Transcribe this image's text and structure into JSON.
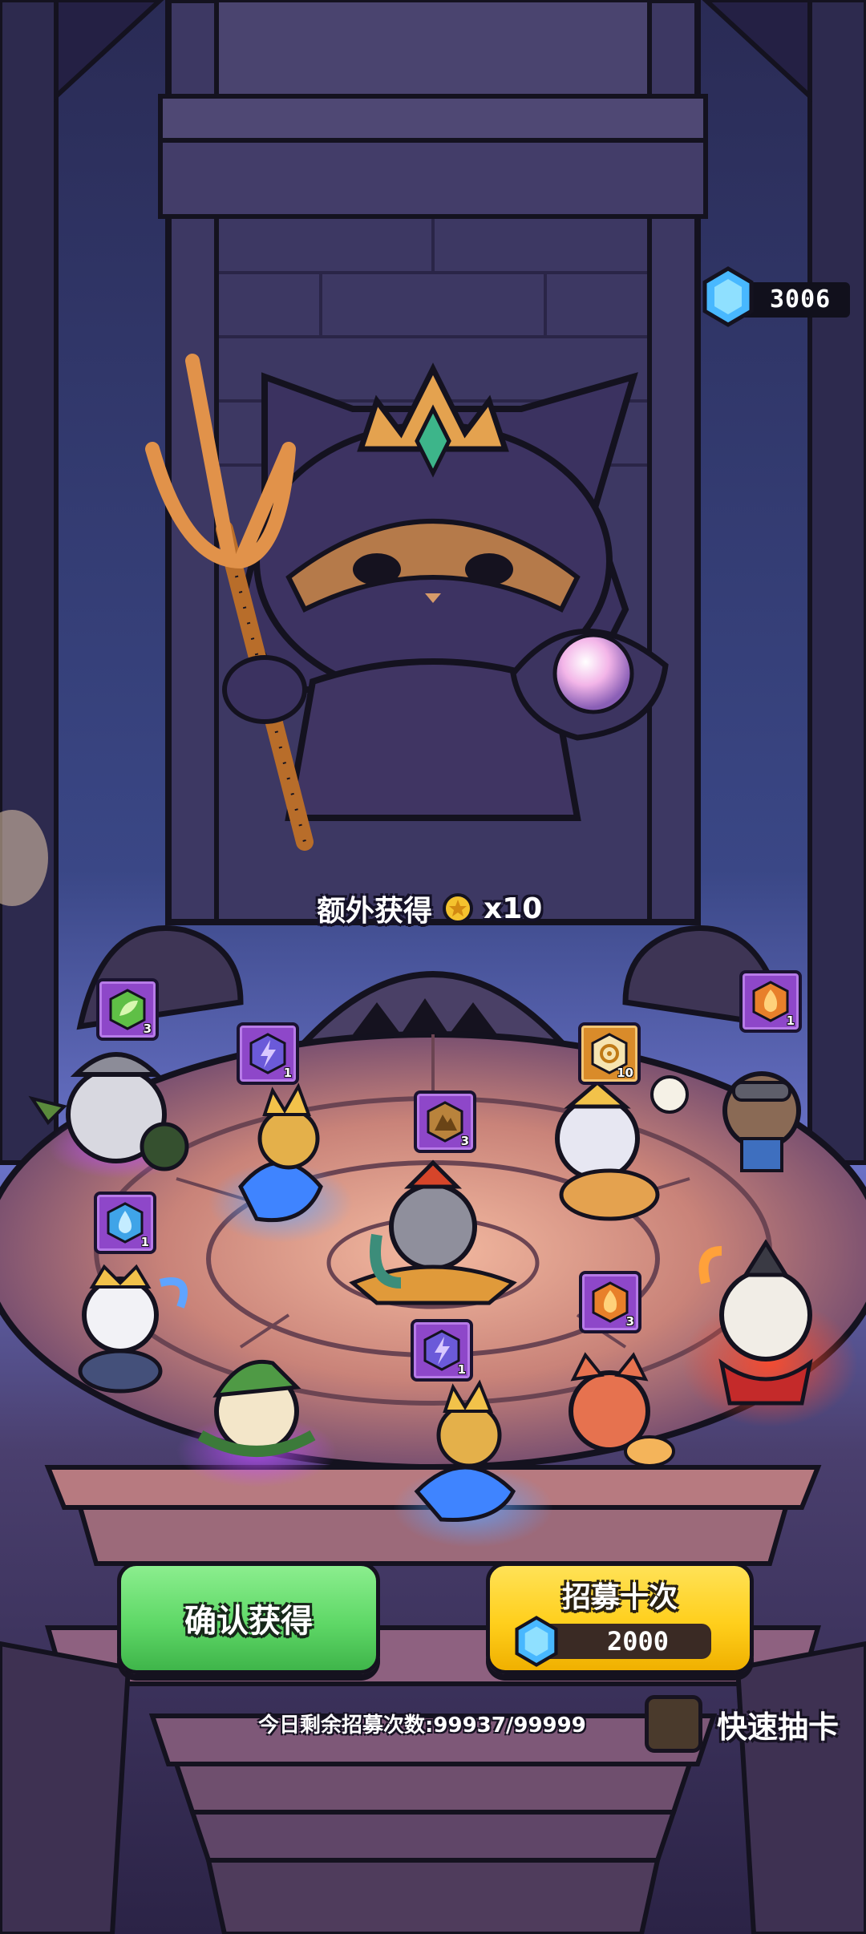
{
  "currency": {
    "gems": "3006",
    "icon": "blue-gem-icon"
  },
  "bonus": {
    "label": "额外获得",
    "icon": "gold-coin-icon",
    "amount": "x10"
  },
  "items": [
    {
      "id": "nature",
      "icon": "green-leaf-gem-icon",
      "qty": "3"
    },
    {
      "id": "lightning-a",
      "icon": "purple-lightning-gem-icon",
      "qty": "1"
    },
    {
      "id": "earth",
      "icon": "brown-earth-gem-icon",
      "qty": "3"
    },
    {
      "id": "golden",
      "icon": "gold-rune-icon",
      "qty": "10"
    },
    {
      "id": "fire-a",
      "icon": "fire-gem-icon",
      "qty": "1"
    },
    {
      "id": "water",
      "icon": "blue-water-gem-icon",
      "qty": "1"
    },
    {
      "id": "fire-b",
      "icon": "fire-gem-icon",
      "qty": "3"
    },
    {
      "id": "lightning-b",
      "icon": "purple-lightning-gem-icon",
      "qty": "1"
    }
  ],
  "buttons": {
    "confirm": "确认获得",
    "recruit": "招募十次",
    "recruit_cost": "2000"
  },
  "remaining": "今日剩余招募次数:99937/99999",
  "quick_draw": {
    "label": "快速抽卡",
    "checked": false
  },
  "colors": {
    "confirm_green": "#5fd867",
    "recruit_yellow": "#ffcf1c",
    "item_purple": "#8e47c9",
    "item_gold": "#d98b2a"
  }
}
